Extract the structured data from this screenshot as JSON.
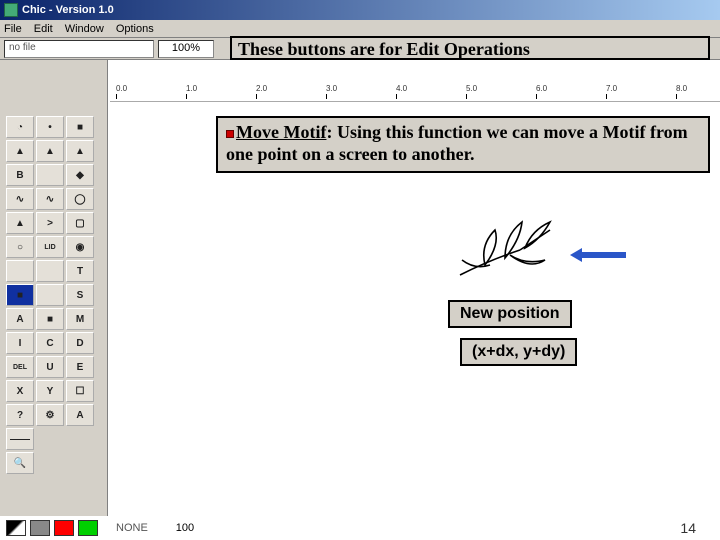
{
  "window": {
    "title": "Chic - Version 1.0"
  },
  "menu": {
    "file": "File",
    "edit": "Edit",
    "window": "Window",
    "options": "Options"
  },
  "toolbar": {
    "file_label": "no file",
    "zoom": "100%"
  },
  "banner": {
    "text": "These buttons are for Edit Operations"
  },
  "ruler": {
    "ticks": [
      "0.0",
      "1.0",
      "2.0",
      "3.0",
      "4.0",
      "5.0",
      "6.0",
      "7.0",
      "8.0"
    ]
  },
  "tools": {
    "r1c2": "•",
    "r1c3": "■",
    "r2c1": "▲",
    "r2c2": "▲",
    "r2c3": "▲",
    "r3c1": "B",
    "r3c3": "◆",
    "r4c1": "∿",
    "r4c2": "∿",
    "r4c3": "◯",
    "r5c1": "▲",
    "r5c2": ">",
    "r5c3": "▢",
    "r6c1": "○",
    "r6c2": "LID",
    "r6c3": "◉",
    "r7c3": "T",
    "r8c1": "■",
    "r8c3": "S",
    "r9c1": "A",
    "r9c2": "■",
    "r9c3": "M",
    "r10c1": "I",
    "r10c2": "C",
    "r10c3": "D",
    "r11c1": "DEL",
    "r11c2": "U",
    "r11c3": "E",
    "r12c1": "X",
    "r12c2": "Y",
    "r12c3": "☐",
    "r13c1": "?",
    "r13c2": "⚙",
    "r13c3": "A",
    "r14c1": "——",
    "r15c1": "🔍"
  },
  "description": {
    "move_title": "Move Motif",
    "move_rest": ": Using this function we can move a Motif from one point on a screen to another."
  },
  "labels": {
    "new_position": "New position",
    "coords": "(x+dx, y+dy)"
  },
  "status": {
    "none": "NONE",
    "value": "100",
    "red": "#ff0000",
    "green": "#00d000"
  },
  "page": "14"
}
